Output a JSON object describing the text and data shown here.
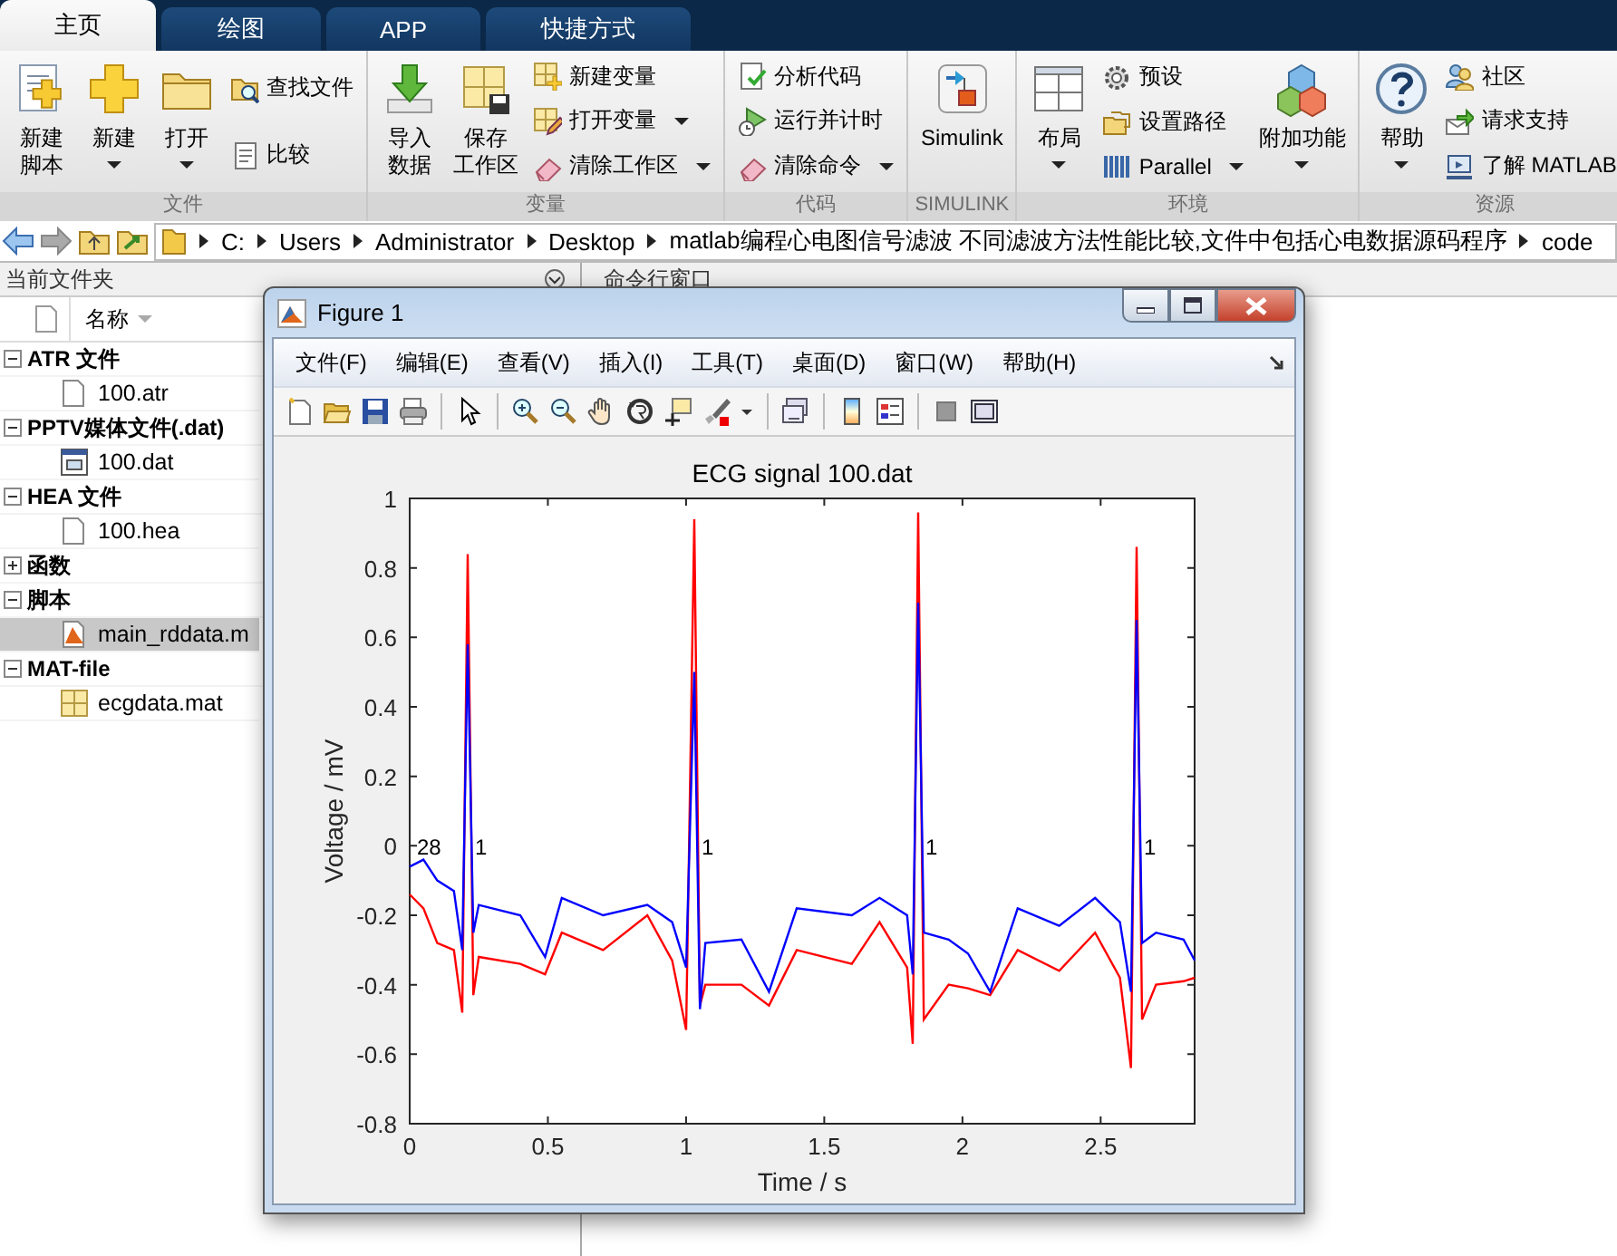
{
  "ribbon": {
    "tabs": [
      {
        "label": "主页",
        "selected": true
      },
      {
        "label": "绘图",
        "selected": false
      },
      {
        "label": "APP",
        "selected": false
      },
      {
        "label": "快捷方式",
        "selected": false
      }
    ],
    "groups": [
      {
        "label": "文件",
        "items": [
          {
            "kind": "large",
            "label": [
              "新建",
              "脚本"
            ],
            "dropdown": false
          },
          {
            "kind": "large",
            "label": "新建",
            "dropdown": true
          },
          {
            "kind": "large",
            "label": "打开",
            "dropdown": true
          },
          {
            "kind": "small",
            "label": "查找文件",
            "dropdown": false
          },
          {
            "kind": "small",
            "label": "比较",
            "dropdown": false
          }
        ]
      },
      {
        "label": "变量",
        "items": [
          {
            "kind": "large",
            "label": [
              "导入",
              "数据"
            ],
            "dropdown": false
          },
          {
            "kind": "large",
            "label": [
              "保存",
              "工作区"
            ],
            "dropdown": false
          },
          {
            "kind": "small",
            "label": "新建变量",
            "dropdown": false
          },
          {
            "kind": "small",
            "label": "打开变量",
            "dropdown": true
          },
          {
            "kind": "small",
            "label": "清除工作区",
            "dropdown": true
          }
        ]
      },
      {
        "label": "代码",
        "items": [
          {
            "kind": "small",
            "label": "分析代码",
            "dropdown": false
          },
          {
            "kind": "small",
            "label": "运行并计时",
            "dropdown": false
          },
          {
            "kind": "small",
            "label": "清除命令",
            "dropdown": true
          }
        ]
      },
      {
        "label": "SIMULINK",
        "items": [
          {
            "kind": "large",
            "label": "Simulink",
            "dropdown": false
          }
        ]
      },
      {
        "label": "环境",
        "items": [
          {
            "kind": "large",
            "label": "布局",
            "dropdown": true
          },
          {
            "kind": "small",
            "label": "预设",
            "dropdown": false
          },
          {
            "kind": "small",
            "label": "设置路径",
            "dropdown": false
          },
          {
            "kind": "small",
            "label": "Parallel",
            "dropdown": true
          },
          {
            "kind": "large",
            "label": "附加功能",
            "dropdown": true
          }
        ]
      },
      {
        "label": "资源",
        "items": [
          {
            "kind": "large",
            "label": "帮助",
            "dropdown": true
          },
          {
            "kind": "small",
            "label": "社区",
            "dropdown": false
          },
          {
            "kind": "small",
            "label": "请求支持",
            "dropdown": false
          },
          {
            "kind": "small",
            "label": "了解 MATLAB",
            "dropdown": false
          }
        ]
      }
    ]
  },
  "address_bar": {
    "path": [
      "C:",
      "Users",
      "Administrator",
      "Desktop",
      "matlab编程心电图信号滤波 不同滤波方法性能比较,文件中包括心电数据源码程序",
      "code"
    ]
  },
  "current_folder": {
    "title": "当前文件夹",
    "column": "名称",
    "groups": [
      {
        "label": "ATR 文件",
        "expanded": true,
        "children": [
          {
            "name": "100.atr",
            "kind": "file",
            "selected": false
          }
        ]
      },
      {
        "label": "PPTV媒体文件(.dat)",
        "expanded": true,
        "children": [
          {
            "name": "100.dat",
            "kind": "media",
            "selected": false
          }
        ]
      },
      {
        "label": "HEA 文件",
        "expanded": true,
        "children": [
          {
            "name": "100.hea",
            "kind": "file",
            "selected": false
          }
        ]
      },
      {
        "label": "函数",
        "expanded": false
      },
      {
        "label": "脚本",
        "expanded": true,
        "children": [
          {
            "name": "main_rddata.m",
            "kind": "script",
            "selected": true
          }
        ]
      },
      {
        "label": "MAT-file",
        "expanded": true,
        "children": [
          {
            "name": "ecgdata.mat",
            "kind": "mat",
            "selected": false
          }
        ]
      }
    ]
  },
  "command_window": {
    "title": "命令行窗口"
  },
  "figure": {
    "title": "Figure 1",
    "menus": [
      "文件(F)",
      "编辑(E)",
      "查看(V)",
      "插入(I)",
      "工具(T)",
      "桌面(D)",
      "窗口(W)",
      "帮助(H)"
    ],
    "chart_data": {
      "type": "line",
      "title": "ECG signal 100.dat",
      "xlabel": "Time / s",
      "ylabel": "Voltage / mV",
      "x": [
        0,
        0.05,
        0.1,
        0.16,
        0.19,
        0.21,
        0.23,
        0.25,
        0.4,
        0.49,
        0.55,
        0.7,
        0.86,
        0.95,
        1.0,
        1.03,
        1.05,
        1.07,
        1.2,
        1.3,
        1.4,
        1.6,
        1.7,
        1.8,
        1.82,
        1.84,
        1.86,
        1.95,
        2.02,
        2.1,
        2.2,
        2.35,
        2.48,
        2.57,
        2.61,
        2.63,
        2.65,
        2.7,
        2.8,
        2.84
      ],
      "series": [
        {
          "color": "#0000ff",
          "values": [
            -0.06,
            -0.04,
            -0.1,
            -0.13,
            -0.3,
            0.58,
            -0.25,
            -0.17,
            -0.2,
            -0.32,
            -0.15,
            -0.2,
            -0.17,
            -0.22,
            -0.35,
            0.5,
            -0.47,
            -0.28,
            -0.27,
            -0.42,
            -0.18,
            -0.2,
            -0.15,
            -0.2,
            -0.37,
            0.7,
            -0.25,
            -0.27,
            -0.31,
            -0.42,
            -0.18,
            -0.23,
            -0.15,
            -0.22,
            -0.42,
            0.65,
            -0.28,
            -0.25,
            -0.27,
            -0.33
          ]
        },
        {
          "color": "#ff0000",
          "values": [
            -0.14,
            -0.18,
            -0.28,
            -0.3,
            -0.48,
            0.84,
            -0.43,
            -0.32,
            -0.34,
            -0.37,
            -0.25,
            -0.3,
            -0.2,
            -0.33,
            -0.53,
            0.94,
            -0.46,
            -0.4,
            -0.4,
            -0.46,
            -0.3,
            -0.34,
            -0.22,
            -0.35,
            -0.57,
            0.96,
            -0.5,
            -0.4,
            -0.41,
            -0.43,
            -0.3,
            -0.36,
            -0.25,
            -0.38,
            -0.64,
            0.86,
            -0.5,
            -0.4,
            -0.39,
            -0.38
          ]
        }
      ],
      "xlim": [
        0,
        2.84
      ],
      "ylim": [
        -0.8,
        1
      ],
      "xticks": [
        0,
        0.5,
        1,
        1.5,
        2,
        2.5
      ],
      "yticks": [
        -0.8,
        -0.6,
        -0.4,
        -0.2,
        0,
        0.2,
        0.4,
        0.6,
        0.8,
        1
      ],
      "annotations": [
        "28",
        "1",
        "1",
        "1",
        "1"
      ]
    }
  }
}
